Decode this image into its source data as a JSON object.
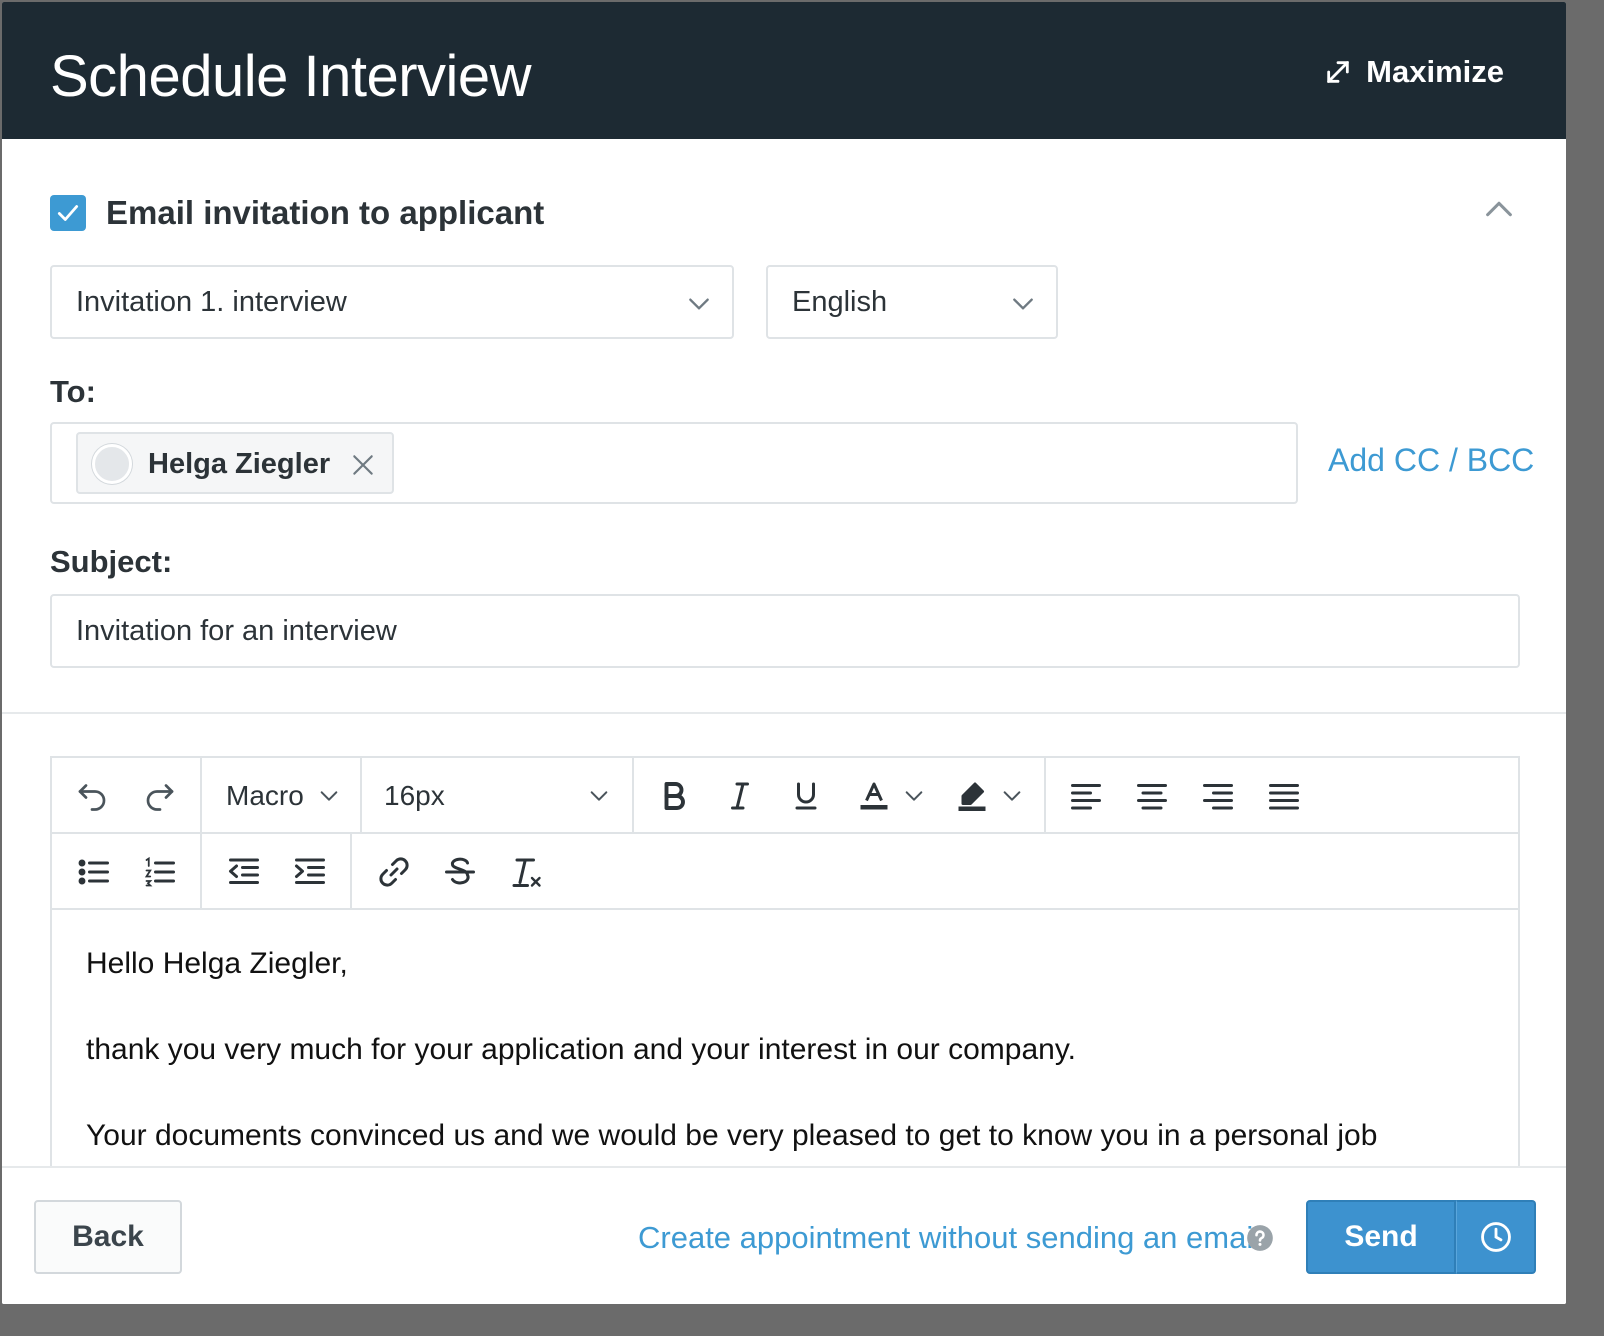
{
  "header": {
    "title": "Schedule Interview",
    "maximize_label": "Maximize"
  },
  "email_invitation": {
    "checked": true,
    "label": "Email invitation to applicant"
  },
  "template_select": {
    "value": "Invitation 1. interview"
  },
  "language_select": {
    "value": "English"
  },
  "to": {
    "label": "To:",
    "recipients": [
      {
        "name": "Helga Ziegler"
      }
    ],
    "add_cc_bcc": "Add CC / BCC"
  },
  "subject": {
    "label": "Subject:",
    "value": "Invitation for an interview"
  },
  "toolbar": {
    "macro_label": "Macro",
    "font_size": "16px"
  },
  "body": {
    "lines": [
      "Hello Helga Ziegler,",
      "thank you very much for your application and your interest in our company.",
      "Your documents convinced us and we would be very pleased to get to know you in a personal job"
    ]
  },
  "footer": {
    "back_label": "Back",
    "create_without_email": "Create appointment without sending an email",
    "send_label": "Send"
  },
  "colors": {
    "header_bg": "#1d2a33",
    "accent": "#3d9ad3"
  }
}
